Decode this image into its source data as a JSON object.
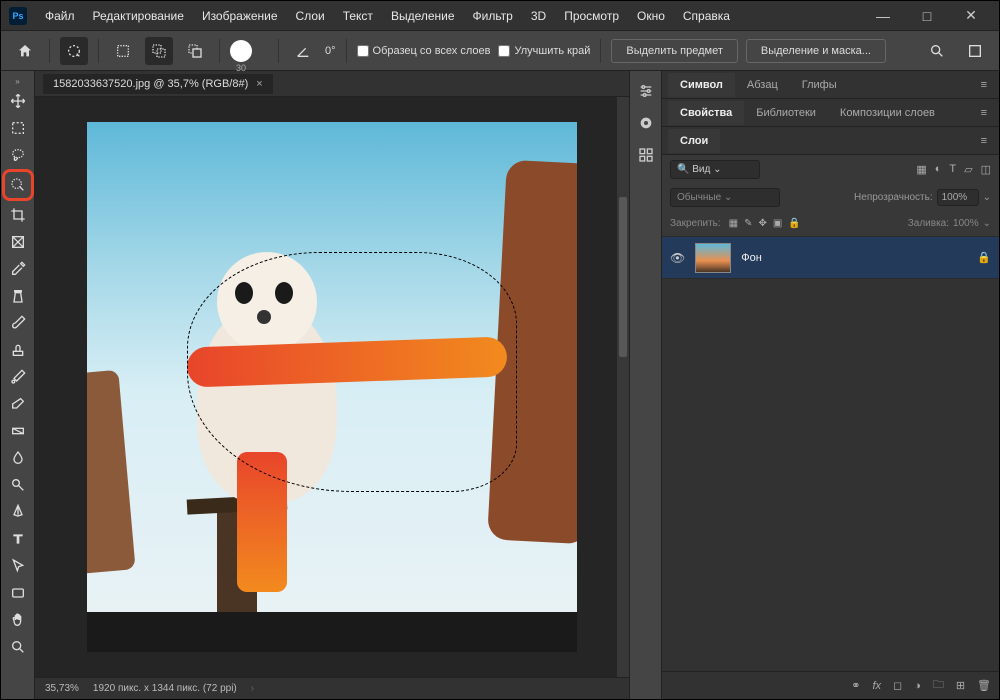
{
  "app": {
    "logo": "Ps"
  },
  "menu": [
    "Файл",
    "Редактирование",
    "Изображение",
    "Слои",
    "Текст",
    "Выделение",
    "Фильтр",
    "3D",
    "Просмотр",
    "Окно",
    "Справка"
  ],
  "winctl": {
    "min": "—",
    "max": "□",
    "close": "✕"
  },
  "options": {
    "brush_size": "30",
    "angle": "0°",
    "sample_all": "Образец со всех слоев",
    "enhance_edge": "Улучшить край",
    "select_subject": "Выделить предмет",
    "select_mask": "Выделение и маска..."
  },
  "document": {
    "tab_title": "1582033637520.jpg @ 35,7% (RGB/8#)",
    "tab_close": "×"
  },
  "status": {
    "zoom": "35,73%",
    "dims": "1920 пикс. x 1344 пикс. (72 ppi)",
    "arrow": "›"
  },
  "panels": {
    "row1": {
      "tabs": [
        "Символ",
        "Абзац",
        "Глифы"
      ],
      "active": 0
    },
    "row2": {
      "tabs": [
        "Свойства",
        "Библиотеки",
        "Композиции слоев"
      ],
      "active": 0
    },
    "row3": {
      "tabs": [
        "Слои"
      ],
      "active": 0
    },
    "layers": {
      "filter_label": "Вид",
      "mode": "Обычные",
      "opacity_label": "Непрозрачность:",
      "opacity_value": "100%",
      "lock_label": "Закрепить:",
      "fill_label": "Заливка:",
      "fill_value": "100%",
      "items": [
        {
          "name": "Фон",
          "locked": true
        }
      ]
    }
  }
}
